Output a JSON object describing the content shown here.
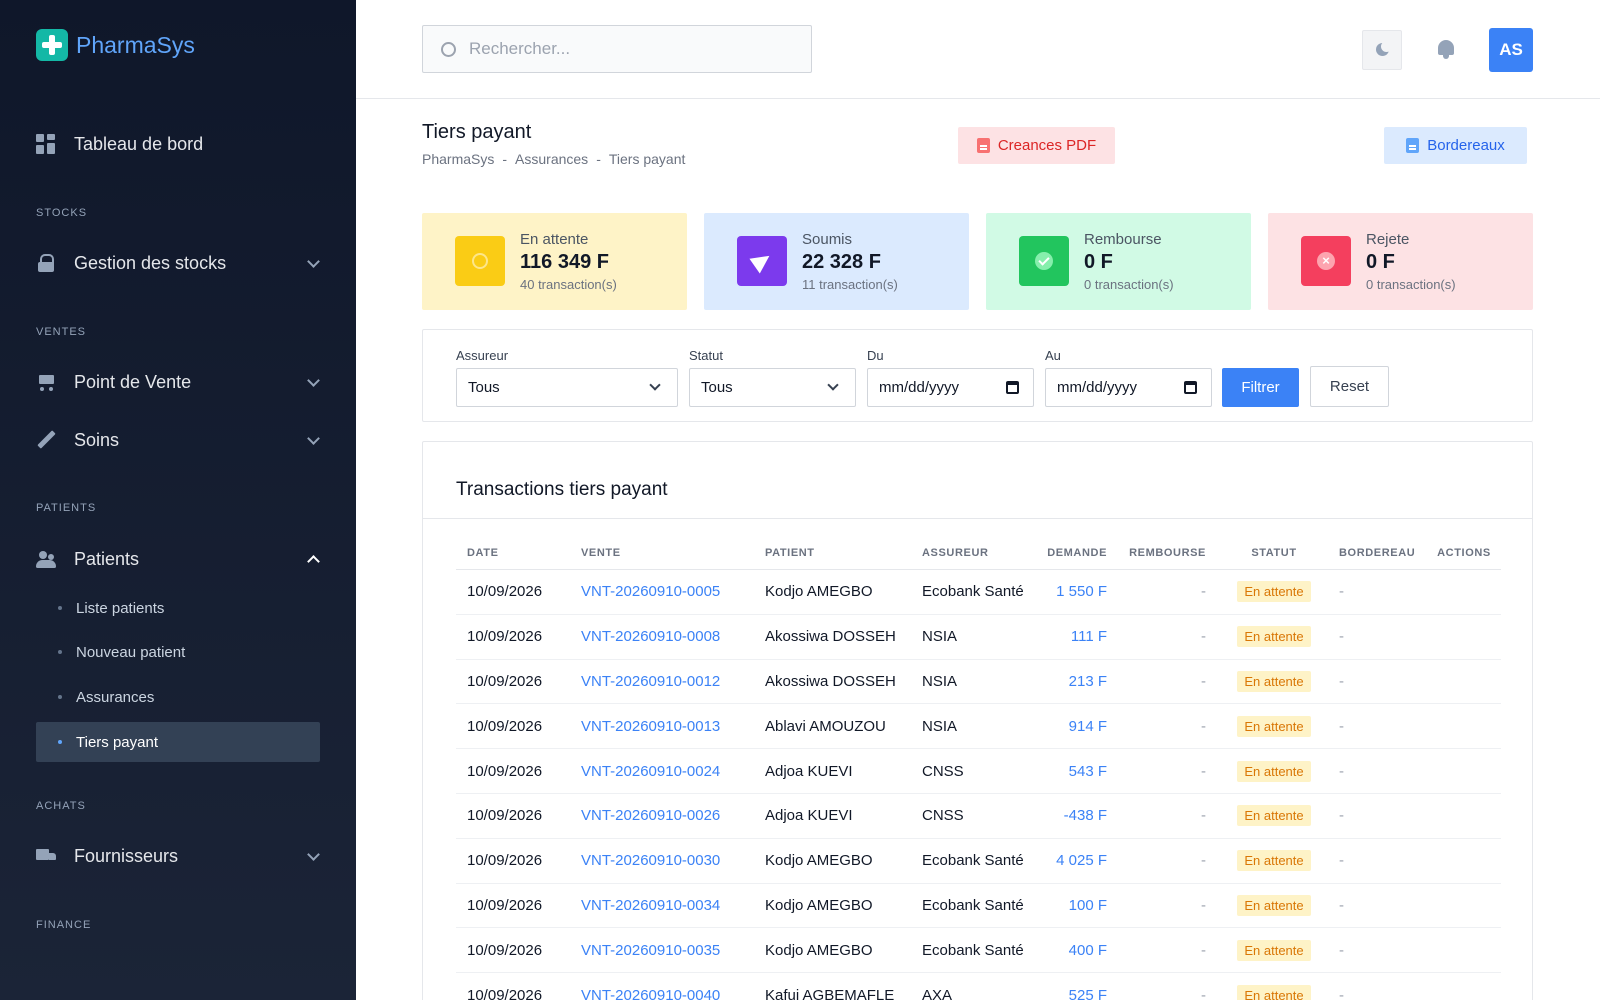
{
  "brand": {
    "name": "PharmaSys"
  },
  "sidebar": {
    "dashboard": "Tableau de bord",
    "sections": {
      "stocks": "STOCKS",
      "ventes": "VENTES",
      "patients": "PATIENTS",
      "achats": "ACHATS",
      "finance": "FINANCE"
    },
    "items": {
      "stocks": "Gestion des stocks",
      "pos": "Point de Vente",
      "soins": "Soins",
      "patients": "Patients",
      "fournisseurs": "Fournisseurs"
    },
    "patients_sub": [
      "Liste patients",
      "Nouveau patient",
      "Assurances",
      "Tiers payant"
    ]
  },
  "header": {
    "search_placeholder": "Rechercher...",
    "avatar_initials": "AS"
  },
  "page": {
    "title": "Tiers payant",
    "breadcrumb": [
      "PharmaSys",
      "Assurances",
      "Tiers payant"
    ],
    "breadcrumb_sep": "-",
    "btn_pdf": "Creances PDF",
    "btn_bordereaux": "Bordereaux"
  },
  "stats": [
    {
      "label": "En attente",
      "value": "116 349 F",
      "sub": "40 transaction(s)",
      "bg": "#fef3c7",
      "icon_bg": "#facc15",
      "icon": "clock-icon"
    },
    {
      "label": "Soumis",
      "value": "22 328 F",
      "sub": "11 transaction(s)",
      "bg": "#dbeafe",
      "icon_bg": "#7c3aed",
      "icon": "send-icon"
    },
    {
      "label": "Rembourse",
      "value": "0 F",
      "sub": "0 transaction(s)",
      "bg": "#d1fae5",
      "icon_bg": "#22c55e",
      "icon": "check-icon"
    },
    {
      "label": "Rejete",
      "value": "0 F",
      "sub": "0 transaction(s)",
      "bg": "#fde2e4",
      "icon_bg": "#f43f5e",
      "icon": "x-icon"
    }
  ],
  "filters": {
    "assureur_label": "Assureur",
    "assureur_value": "Tous",
    "statut_label": "Statut",
    "statut_value": "Tous",
    "du_label": "Du",
    "du_value": "mm/dd/yyyy",
    "au_label": "Au",
    "au_value": "mm/dd/yyyy",
    "btn_filtrer": "Filtrer",
    "btn_reset": "Reset"
  },
  "table": {
    "title": "Transactions tiers payant",
    "headers": [
      "DATE",
      "VENTE",
      "PATIENT",
      "ASSUREUR",
      "DEMANDE",
      "REMBOURSE",
      "STATUT",
      "BORDEREAU",
      "ACTIONS"
    ],
    "rows": [
      {
        "date": "10/09/2026",
        "vente": "VNT-20260910-0005",
        "patient": "Kodjo AMEGBO",
        "assureur": "Ecobank Santé",
        "demande": "1 550 F",
        "rembourse": "-",
        "statut": "En attente",
        "bordereau": "-"
      },
      {
        "date": "10/09/2026",
        "vente": "VNT-20260910-0008",
        "patient": "Akossiwa DOSSEH",
        "assureur": "NSIA",
        "demande": "111 F",
        "rembourse": "-",
        "statut": "En attente",
        "bordereau": "-"
      },
      {
        "date": "10/09/2026",
        "vente": "VNT-20260910-0012",
        "patient": "Akossiwa DOSSEH",
        "assureur": "NSIA",
        "demande": "213 F",
        "rembourse": "-",
        "statut": "En attente",
        "bordereau": "-"
      },
      {
        "date": "10/09/2026",
        "vente": "VNT-20260910-0013",
        "patient": "Ablavi AMOUZOU",
        "assureur": "NSIA",
        "demande": "914 F",
        "rembourse": "-",
        "statut": "En attente",
        "bordereau": "-"
      },
      {
        "date": "10/09/2026",
        "vente": "VNT-20260910-0024",
        "patient": "Adjoa KUEVI",
        "assureur": "CNSS",
        "demande": "543 F",
        "rembourse": "-",
        "statut": "En attente",
        "bordereau": "-"
      },
      {
        "date": "10/09/2026",
        "vente": "VNT-20260910-0026",
        "patient": "Adjoa KUEVI",
        "assureur": "CNSS",
        "demande": "-438 F",
        "rembourse": "-",
        "statut": "En attente",
        "bordereau": "-"
      },
      {
        "date": "10/09/2026",
        "vente": "VNT-20260910-0030",
        "patient": "Kodjo AMEGBO",
        "assureur": "Ecobank Santé",
        "demande": "4 025 F",
        "rembourse": "-",
        "statut": "En attente",
        "bordereau": "-"
      },
      {
        "date": "10/09/2026",
        "vente": "VNT-20260910-0034",
        "patient": "Kodjo AMEGBO",
        "assureur": "Ecobank Santé",
        "demande": "100 F",
        "rembourse": "-",
        "statut": "En attente",
        "bordereau": "-"
      },
      {
        "date": "10/09/2026",
        "vente": "VNT-20260910-0035",
        "patient": "Kodjo AMEGBO",
        "assureur": "Ecobank Santé",
        "demande": "400 F",
        "rembourse": "-",
        "statut": "En attente",
        "bordereau": "-"
      },
      {
        "date": "10/09/2026",
        "vente": "VNT-20260910-0040",
        "patient": "Kafui AGBEMAFLE",
        "assureur": "AXA",
        "demande": "525 F",
        "rembourse": "-",
        "statut": "En attente",
        "bordereau": "-"
      }
    ]
  }
}
